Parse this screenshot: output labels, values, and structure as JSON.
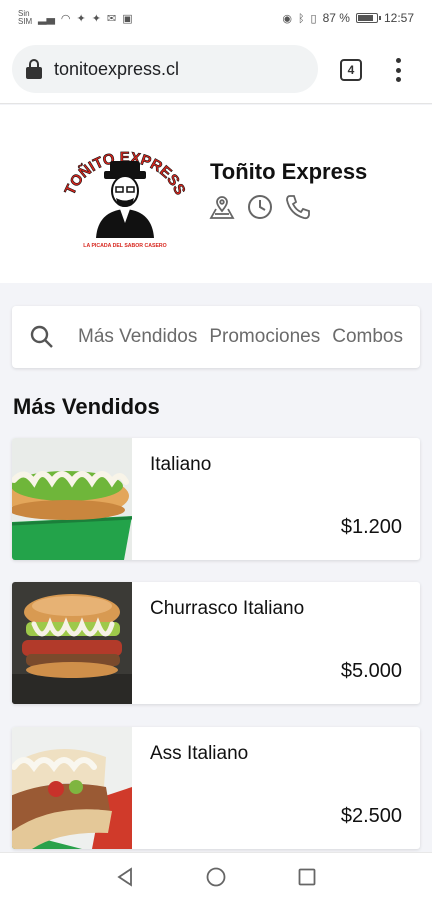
{
  "status_bar": {
    "carrier": "Sin SIM",
    "battery_percent": "87 %",
    "time": "12:57",
    "left_icons": [
      "signal-icon",
      "wifi-icon",
      "twitter-icon",
      "twitter-icon",
      "mail-icon",
      "gallery-icon"
    ],
    "right_icons": [
      "eye-icon",
      "bluetooth-icon",
      "vibrate-icon",
      "battery-icon"
    ]
  },
  "browser": {
    "url": "tonitoexpress.cl",
    "tab_count": "4"
  },
  "store": {
    "name": "Toñito Express",
    "logo_text_top": "TOÑITO EXPRESS",
    "logo_text_bottom": "LA PICADA DEL SABOR CASERO",
    "icons": [
      "location-pin-icon",
      "clock-icon",
      "phone-icon"
    ]
  },
  "categories": [
    "Más Vendidos",
    "Promociones",
    "Combos"
  ],
  "section_title": "Más Vendidos",
  "products": [
    {
      "name": "Italiano",
      "price": "$1.200"
    },
    {
      "name": "Churrasco Italiano",
      "price": "$5.000"
    },
    {
      "name": "Ass Italiano",
      "price": "$2.500"
    }
  ],
  "colors": {
    "background": "#f3f4f8",
    "card": "#ffffff",
    "brand_red": "#d7261e",
    "text": "#111111",
    "muted": "#6b6b6b"
  }
}
